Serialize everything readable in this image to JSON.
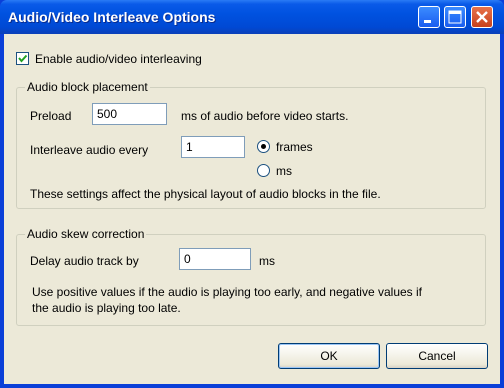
{
  "window": {
    "title": "Audio/Video Interleave Options"
  },
  "enable": {
    "label": "Enable audio/video interleaving",
    "checked": true
  },
  "audio_block": {
    "legend": "Audio block placement",
    "preload_label": "Preload",
    "preload_value": "500",
    "preload_suffix": "ms of audio before video starts.",
    "interleave_label": "Interleave audio every",
    "interleave_value": "1",
    "unit_frames": "frames",
    "unit_ms": "ms",
    "selected_unit": "frames",
    "note": "These settings affect the physical layout of audio blocks in the file."
  },
  "skew": {
    "legend": "Audio skew correction",
    "delay_label": "Delay audio track by",
    "delay_value": "0",
    "delay_suffix": "ms",
    "note_line1": "Use positive values if the audio is playing too early, and negative values if",
    "note_line2": "the audio is playing too late."
  },
  "buttons": {
    "ok": "OK",
    "cancel": "Cancel"
  }
}
